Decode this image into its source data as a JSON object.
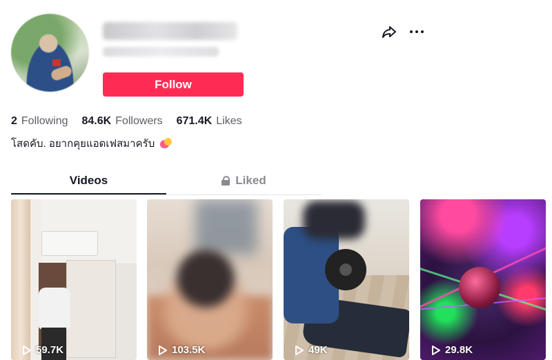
{
  "profile": {
    "follow_label": "Follow"
  },
  "stats": [
    {
      "value": "2",
      "label": "Following"
    },
    {
      "value": "84.6K",
      "label": "Followers"
    },
    {
      "value": "671.4K",
      "label": "Likes"
    }
  ],
  "bio": "โสดคับ. อยากคุยแอดเฟสมาครับ",
  "tabs": {
    "videos": "Videos",
    "liked": "Liked"
  },
  "videos": [
    {
      "views": "59.7K"
    },
    {
      "views": "103.5K"
    },
    {
      "views": "49K"
    },
    {
      "views": "29.8K"
    }
  ],
  "colors": {
    "accent": "#fe2c55",
    "text": "#161823",
    "muted": "#5c5d64"
  }
}
